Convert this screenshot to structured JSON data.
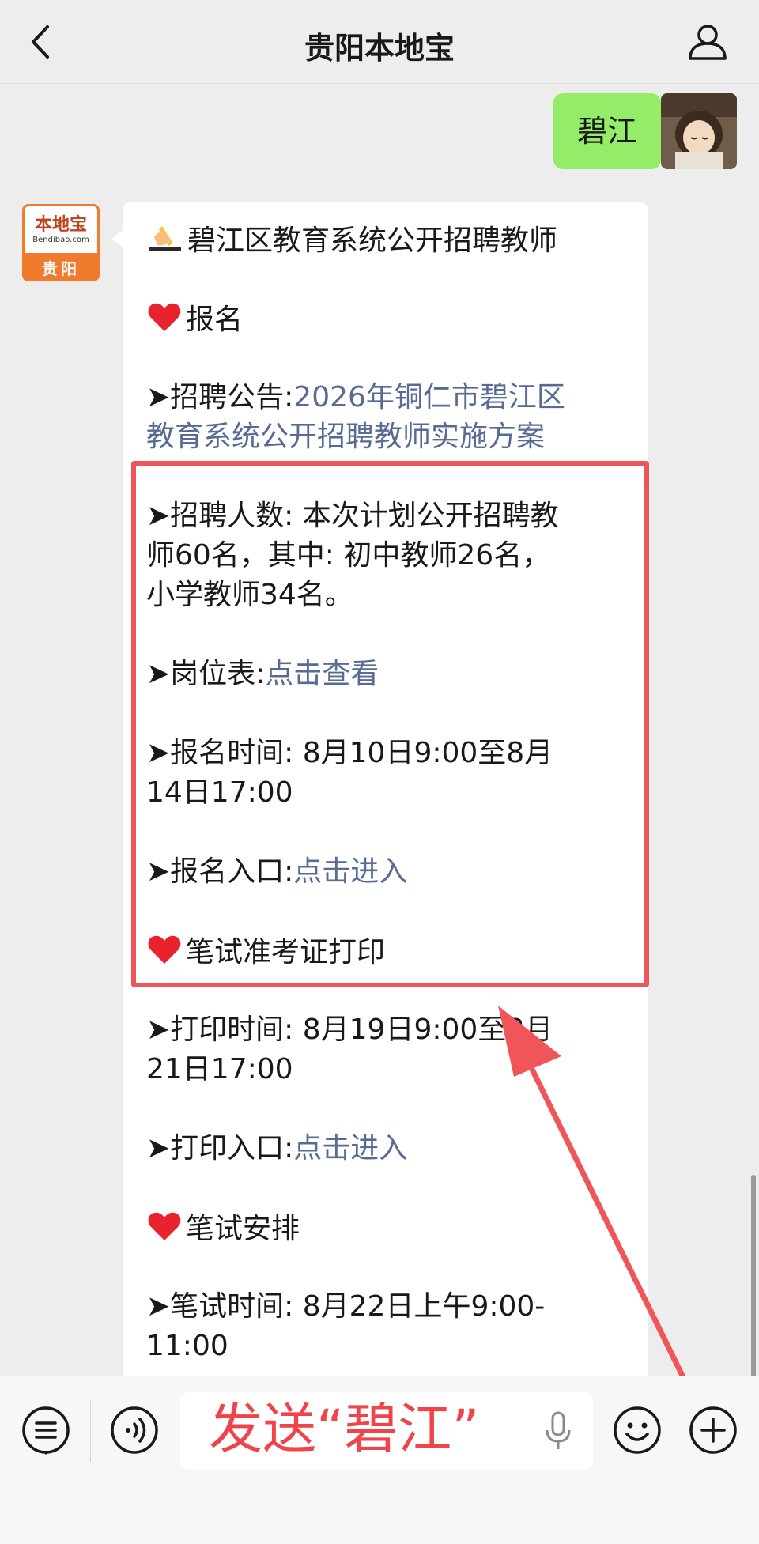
{
  "header": {
    "title": "贵阳本地宝",
    "back_icon": "chevron-left-icon",
    "profile_icon": "person-icon"
  },
  "my_message": {
    "text": "碧江"
  },
  "bot": {
    "avatar_logo": "本地宝",
    "avatar_domain": "Bendibao.com",
    "avatar_city": "贵阳"
  },
  "article": {
    "heading": "碧江区教育系统公开招聘教师",
    "section_signup": "报名",
    "notice_label": "➤招聘公告:",
    "notice_link_1": "2026年铜仁市碧江区",
    "notice_link_2": "教育系统公开招聘教师实施方案",
    "count_1": "➤招聘人数: 本次计划公开招聘教",
    "count_2": "师60名，其中: 初中教师26名，",
    "count_3": "小学教师34名。",
    "post_label": "➤岗位表:",
    "post_link": "点击查看",
    "signup_time_1": "➤报名时间: 8月10日9:00至8月",
    "signup_time_2": "14日17:00",
    "signup_entry_label": "➤报名入口:",
    "signup_entry_link": "点击进入",
    "section_print": "笔试准考证打印",
    "print_time_1": "➤打印时间: 8月19日9:00至8月",
    "print_time_2": "21日17:00",
    "print_entry_label": "➤打印入口:",
    "print_entry_link": "点击进入",
    "section_exam": "笔试安排",
    "exam_time_1": "➤笔试时间: 8月22日上午9:00-",
    "exam_time_2": "11:00"
  },
  "input": {
    "overlay_text": "发送“碧江”"
  },
  "colors": {
    "my_bubble": "#95ec69",
    "link": "#576b95",
    "highlight": "#f0555a",
    "overlay_text": "#f0444a"
  },
  "icons": {
    "menu": "list-icon",
    "voice": "voice-icon",
    "mic": "microphone-icon",
    "emoji": "smiley-icon",
    "plus": "plus-circle-icon"
  }
}
